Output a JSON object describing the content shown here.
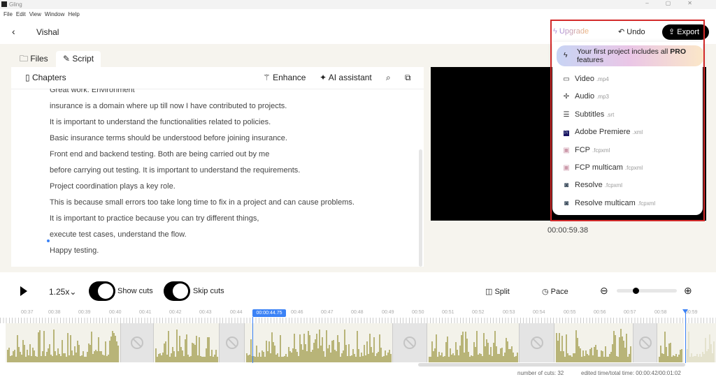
{
  "window": {
    "title": "Gling",
    "menu": [
      "File",
      "Edit",
      "View",
      "Window",
      "Help"
    ]
  },
  "header": {
    "project": "Vishal",
    "upgrade": "Upgrade",
    "undo": "Undo",
    "export": "Export"
  },
  "tabs": [
    {
      "label": "Files"
    },
    {
      "label": "Script",
      "active": true
    }
  ],
  "script_toolbar": {
    "chapters": "Chapters",
    "enhance": "Enhance",
    "ai": "AI assistant"
  },
  "script_lines": [
    "Great work. Environment",
    "insurance is a domain where up till now I have contributed to projects.",
    "It is important to understand the functionalities related to policies.",
    "Basic insurance terms should be understood before joining insurance.",
    "Front end and backend testing. Both are being carried out by me",
    "before carrying out testing. It is important to understand the requirements.",
    "Project coordination plays a key role.",
    "This is because small errors too take long time to fix in a project and can cause problems.",
    "It is important to practice because you can try different things,",
    "execute test cases, understand the flow.",
    "Happy testing."
  ],
  "video": {
    "timestamp": "00:00:59.38"
  },
  "export_menu": {
    "promo_prefix": "Your first project includes all ",
    "promo_bold": "PRO",
    "promo_suffix": " features",
    "items": [
      {
        "label": "Video",
        "ext": ".mp4",
        "icon": "video-icon"
      },
      {
        "label": "Audio",
        "ext": ".mp3",
        "icon": "audio-icon"
      },
      {
        "label": "Subtitles",
        "ext": ".srt",
        "icon": "subtitles-icon"
      },
      {
        "label": "Adobe Premiere",
        "ext": ".xml",
        "icon": "premiere-icon"
      },
      {
        "label": "FCP",
        "ext": ".fcpxml",
        "icon": "fcp-icon"
      },
      {
        "label": "FCP multicam",
        "ext": ".fcpxml",
        "icon": "fcp-icon"
      },
      {
        "label": "Resolve",
        "ext": ".fcpxml",
        "icon": "resolve-icon"
      },
      {
        "label": "Resolve multicam",
        "ext": ".fcpxml",
        "icon": "resolve-icon"
      }
    ]
  },
  "controls": {
    "speed": "1.25x",
    "show_cuts": "Show cuts",
    "skip_cuts": "Skip cuts",
    "split": "Split",
    "pace": "Pace",
    "zoom_level": 0.3
  },
  "timeline": {
    "ticks": [
      "00:37",
      "00:38",
      "00:39",
      "00:40",
      "00:41",
      "00:42",
      "00:43",
      "00:44",
      "00:46",
      "00:47",
      "00:48",
      "00:49",
      "00:50",
      "00:51",
      "00:52",
      "00:53",
      "00:54",
      "00:55",
      "00:56",
      "00:57",
      "00:58",
      "00:59"
    ],
    "playhead": "00:00:44.75"
  },
  "footer": {
    "cuts": "number of cuts: 32",
    "time": "edited time/total time: 00:00:42/00:01:02"
  },
  "colors": {
    "accent": "#3b82f6",
    "waveform": "#b8b478",
    "highlight": "#d32a2a"
  }
}
